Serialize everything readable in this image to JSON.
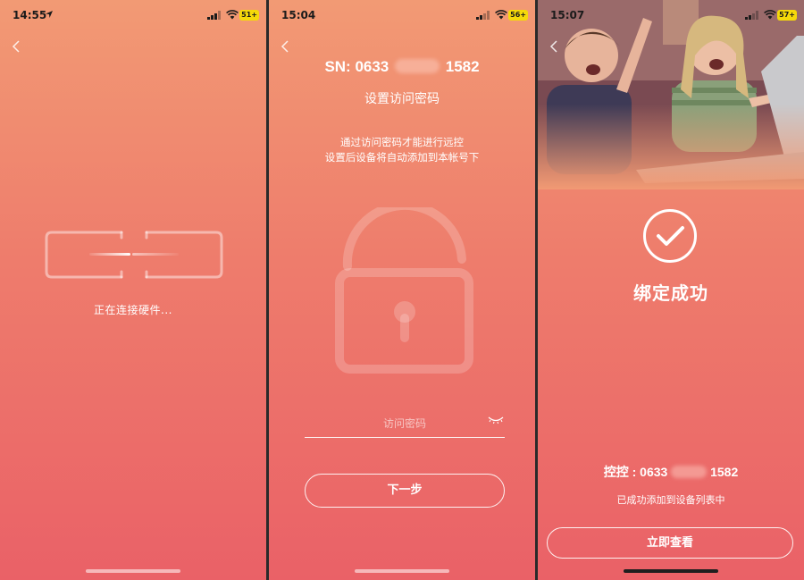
{
  "screen1": {
    "status": {
      "time": "14:55",
      "battery": "51+"
    },
    "connecting_text": "正在连接硬件..."
  },
  "screen2": {
    "status": {
      "time": "15:04",
      "battery": "56+"
    },
    "sn_prefix": "SN: 0633",
    "sn_suffix": "1582",
    "title": "设置访问密码",
    "description_line1": "通过访问密码才能进行远控",
    "description_line2": "设置后设备将自动添加到本帐号下",
    "password_placeholder": "访问密码",
    "next_button": "下一步"
  },
  "screen3": {
    "status": {
      "time": "15:07",
      "battery": "57+"
    },
    "success_title": "绑定成功",
    "device_prefix": "控控 : 0633",
    "device_suffix": "1582",
    "added_text": "已成功添加到设备列表中",
    "view_button": "立即查看"
  },
  "colors": {
    "gradient_top": "#f29a74",
    "gradient_bottom": "#ea6167",
    "battery": "#f5d90a"
  },
  "icons": [
    "back-arrow-icon",
    "location-arrow-icon",
    "signal-icon",
    "wifi-icon",
    "battery-icon",
    "broken-link-icon",
    "lock-icon",
    "eye-closed-icon",
    "checkmark-circle-icon"
  ]
}
